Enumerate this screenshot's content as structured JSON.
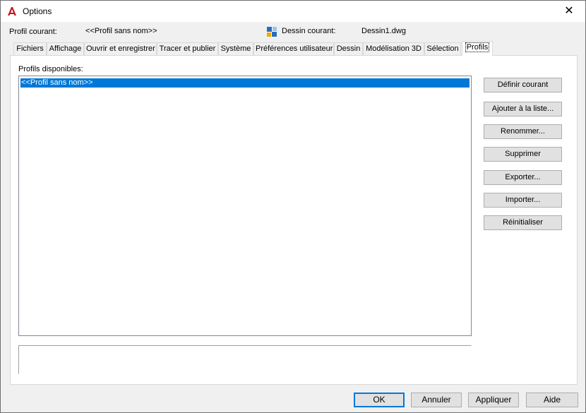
{
  "window": {
    "title": "Options",
    "close_glyph": "✕"
  },
  "header": {
    "profile_label": "Profil courant:",
    "profile_value": "<<Profil sans nom>>",
    "drawing_label": "Dessin courant:",
    "drawing_value": "Dessin1.dwg"
  },
  "tabs": [
    {
      "label": "Fichiers"
    },
    {
      "label": "Affichage"
    },
    {
      "label": "Ouvrir et enregistrer"
    },
    {
      "label": "Tracer et publier"
    },
    {
      "label": "Système"
    },
    {
      "label": "Préférences utilisateur"
    },
    {
      "label": "Dessin"
    },
    {
      "label": "Modélisation 3D"
    },
    {
      "label": "Sélection"
    },
    {
      "label": "Profils",
      "active": true
    }
  ],
  "profiles": {
    "list_label": "Profils disponibles:",
    "items": [
      "<<Profil sans nom>>"
    ],
    "selected_index": 0
  },
  "buttons": {
    "set_current": "Définir courant",
    "add_to_list": "Ajouter à la liste...",
    "rename": "Renommer...",
    "delete": "Supprimer",
    "export": "Exporter...",
    "import": "Importer...",
    "reset": "Réinitialiser"
  },
  "footer": {
    "ok": "OK",
    "cancel": "Annuler",
    "apply": "Appliquer",
    "help": "Aide"
  },
  "colors": {
    "selection": "#0078d7",
    "app_icon": "#c4161c"
  }
}
